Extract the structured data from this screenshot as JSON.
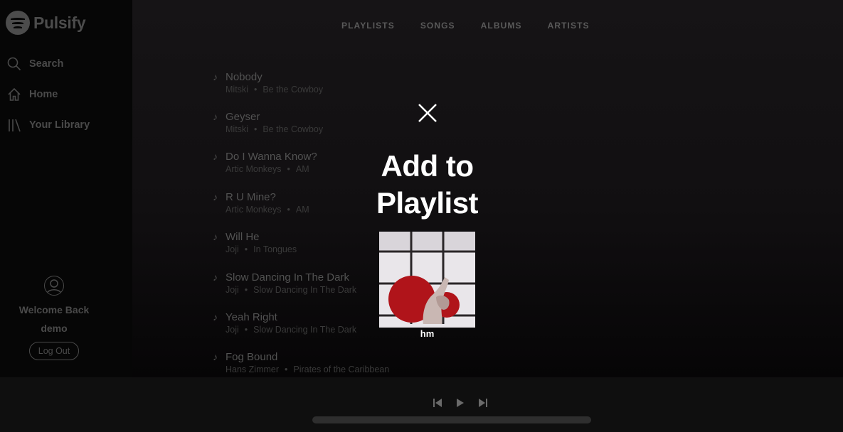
{
  "app": {
    "name": "Pulsify"
  },
  "sidebar": {
    "items": [
      {
        "label": "Search",
        "icon": "search-icon"
      },
      {
        "label": "Home",
        "icon": "home-icon"
      },
      {
        "label": "Your Library",
        "icon": "library-icon"
      }
    ],
    "user": {
      "welcome": "Welcome Back",
      "username": "demo",
      "logout_label": "Log Out"
    }
  },
  "tabs": [
    "PLAYLISTS",
    "SONGS",
    "ALBUMS",
    "ARTISTS"
  ],
  "songs": [
    {
      "title": "Nobody",
      "artist": "Mitski",
      "album": "Be the Cowboy"
    },
    {
      "title": "Geyser",
      "artist": "Mitski",
      "album": "Be the Cowboy"
    },
    {
      "title": "Do I Wanna Know?",
      "artist": "Artic Monkeys",
      "album": "AM"
    },
    {
      "title": "R U Mine?",
      "artist": "Artic Monkeys",
      "album": "AM"
    },
    {
      "title": "Will He",
      "artist": "Joji",
      "album": "In Tongues"
    },
    {
      "title": "Slow Dancing In The Dark",
      "artist": "Joji",
      "album": "Slow Dancing In The Dark"
    },
    {
      "title": "Yeah Right",
      "artist": "Joji",
      "album": "Slow Dancing In The Dark"
    },
    {
      "title": "Fog Bound",
      "artist": "Hans Zimmer",
      "album": "Pirates of the Caribbean"
    }
  ],
  "separator": "•",
  "modal": {
    "title_line1": "Add to",
    "title_line2": "Playlist",
    "playlists": [
      {
        "name": "hm"
      }
    ]
  },
  "colors": {
    "accent": "#ffffff",
    "sidebar_bg": "#060606",
    "player_bg": "#0f0f0f",
    "cover_red": "#b0141a"
  }
}
